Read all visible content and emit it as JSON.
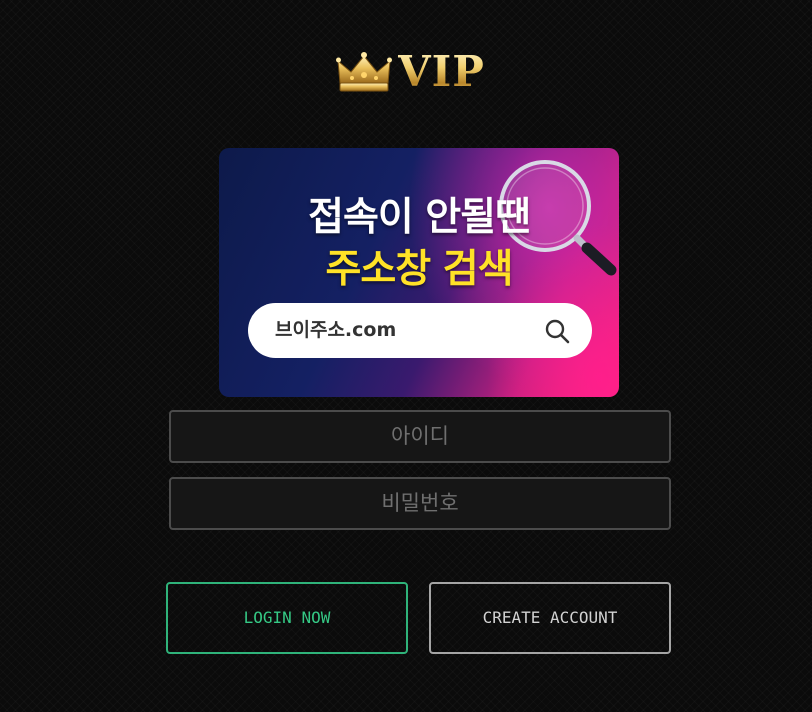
{
  "logo": {
    "text": "VIP",
    "icon": "crown-icon"
  },
  "banner": {
    "line1": "접속이 안될땐",
    "line2": "주소창 검색",
    "search_text": "브이주소.com",
    "search_icon": "search-icon",
    "magnifier_icon": "magnifier-icon"
  },
  "form": {
    "id_placeholder": "아이디",
    "password_placeholder": "비밀번호"
  },
  "buttons": {
    "login": "LOGIN NOW",
    "create": "CREATE ACCOUNT"
  },
  "colors": {
    "background": "#0b0b0b",
    "gold": "#e5bb55",
    "accent_green": "#2fb37a",
    "banner_yellow": "#ffe227",
    "banner_pink": "#ff2a7a",
    "banner_navy": "#142063"
  }
}
